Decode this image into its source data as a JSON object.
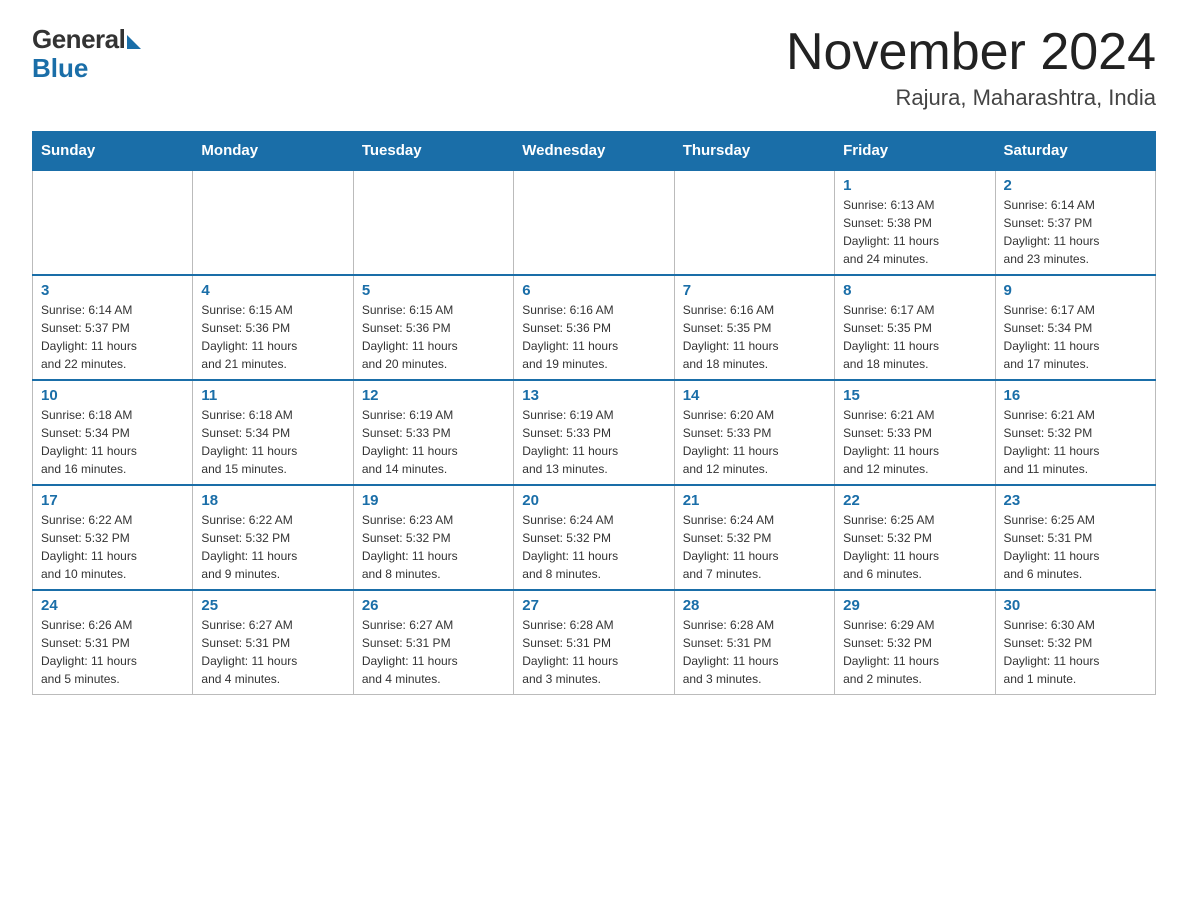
{
  "header": {
    "logo_general": "General",
    "logo_blue": "Blue",
    "month_title": "November 2024",
    "location": "Rajura, Maharashtra, India"
  },
  "days_of_week": [
    "Sunday",
    "Monday",
    "Tuesday",
    "Wednesday",
    "Thursday",
    "Friday",
    "Saturday"
  ],
  "weeks": [
    [
      {
        "day": "",
        "info": ""
      },
      {
        "day": "",
        "info": ""
      },
      {
        "day": "",
        "info": ""
      },
      {
        "day": "",
        "info": ""
      },
      {
        "day": "",
        "info": ""
      },
      {
        "day": "1",
        "info": "Sunrise: 6:13 AM\nSunset: 5:38 PM\nDaylight: 11 hours\nand 24 minutes."
      },
      {
        "day": "2",
        "info": "Sunrise: 6:14 AM\nSunset: 5:37 PM\nDaylight: 11 hours\nand 23 minutes."
      }
    ],
    [
      {
        "day": "3",
        "info": "Sunrise: 6:14 AM\nSunset: 5:37 PM\nDaylight: 11 hours\nand 22 minutes."
      },
      {
        "day": "4",
        "info": "Sunrise: 6:15 AM\nSunset: 5:36 PM\nDaylight: 11 hours\nand 21 minutes."
      },
      {
        "day": "5",
        "info": "Sunrise: 6:15 AM\nSunset: 5:36 PM\nDaylight: 11 hours\nand 20 minutes."
      },
      {
        "day": "6",
        "info": "Sunrise: 6:16 AM\nSunset: 5:36 PM\nDaylight: 11 hours\nand 19 minutes."
      },
      {
        "day": "7",
        "info": "Sunrise: 6:16 AM\nSunset: 5:35 PM\nDaylight: 11 hours\nand 18 minutes."
      },
      {
        "day": "8",
        "info": "Sunrise: 6:17 AM\nSunset: 5:35 PM\nDaylight: 11 hours\nand 18 minutes."
      },
      {
        "day": "9",
        "info": "Sunrise: 6:17 AM\nSunset: 5:34 PM\nDaylight: 11 hours\nand 17 minutes."
      }
    ],
    [
      {
        "day": "10",
        "info": "Sunrise: 6:18 AM\nSunset: 5:34 PM\nDaylight: 11 hours\nand 16 minutes."
      },
      {
        "day": "11",
        "info": "Sunrise: 6:18 AM\nSunset: 5:34 PM\nDaylight: 11 hours\nand 15 minutes."
      },
      {
        "day": "12",
        "info": "Sunrise: 6:19 AM\nSunset: 5:33 PM\nDaylight: 11 hours\nand 14 minutes."
      },
      {
        "day": "13",
        "info": "Sunrise: 6:19 AM\nSunset: 5:33 PM\nDaylight: 11 hours\nand 13 minutes."
      },
      {
        "day": "14",
        "info": "Sunrise: 6:20 AM\nSunset: 5:33 PM\nDaylight: 11 hours\nand 12 minutes."
      },
      {
        "day": "15",
        "info": "Sunrise: 6:21 AM\nSunset: 5:33 PM\nDaylight: 11 hours\nand 12 minutes."
      },
      {
        "day": "16",
        "info": "Sunrise: 6:21 AM\nSunset: 5:32 PM\nDaylight: 11 hours\nand 11 minutes."
      }
    ],
    [
      {
        "day": "17",
        "info": "Sunrise: 6:22 AM\nSunset: 5:32 PM\nDaylight: 11 hours\nand 10 minutes."
      },
      {
        "day": "18",
        "info": "Sunrise: 6:22 AM\nSunset: 5:32 PM\nDaylight: 11 hours\nand 9 minutes."
      },
      {
        "day": "19",
        "info": "Sunrise: 6:23 AM\nSunset: 5:32 PM\nDaylight: 11 hours\nand 8 minutes."
      },
      {
        "day": "20",
        "info": "Sunrise: 6:24 AM\nSunset: 5:32 PM\nDaylight: 11 hours\nand 8 minutes."
      },
      {
        "day": "21",
        "info": "Sunrise: 6:24 AM\nSunset: 5:32 PM\nDaylight: 11 hours\nand 7 minutes."
      },
      {
        "day": "22",
        "info": "Sunrise: 6:25 AM\nSunset: 5:32 PM\nDaylight: 11 hours\nand 6 minutes."
      },
      {
        "day": "23",
        "info": "Sunrise: 6:25 AM\nSunset: 5:31 PM\nDaylight: 11 hours\nand 6 minutes."
      }
    ],
    [
      {
        "day": "24",
        "info": "Sunrise: 6:26 AM\nSunset: 5:31 PM\nDaylight: 11 hours\nand 5 minutes."
      },
      {
        "day": "25",
        "info": "Sunrise: 6:27 AM\nSunset: 5:31 PM\nDaylight: 11 hours\nand 4 minutes."
      },
      {
        "day": "26",
        "info": "Sunrise: 6:27 AM\nSunset: 5:31 PM\nDaylight: 11 hours\nand 4 minutes."
      },
      {
        "day": "27",
        "info": "Sunrise: 6:28 AM\nSunset: 5:31 PM\nDaylight: 11 hours\nand 3 minutes."
      },
      {
        "day": "28",
        "info": "Sunrise: 6:28 AM\nSunset: 5:31 PM\nDaylight: 11 hours\nand 3 minutes."
      },
      {
        "day": "29",
        "info": "Sunrise: 6:29 AM\nSunset: 5:32 PM\nDaylight: 11 hours\nand 2 minutes."
      },
      {
        "day": "30",
        "info": "Sunrise: 6:30 AM\nSunset: 5:32 PM\nDaylight: 11 hours\nand 1 minute."
      }
    ]
  ]
}
